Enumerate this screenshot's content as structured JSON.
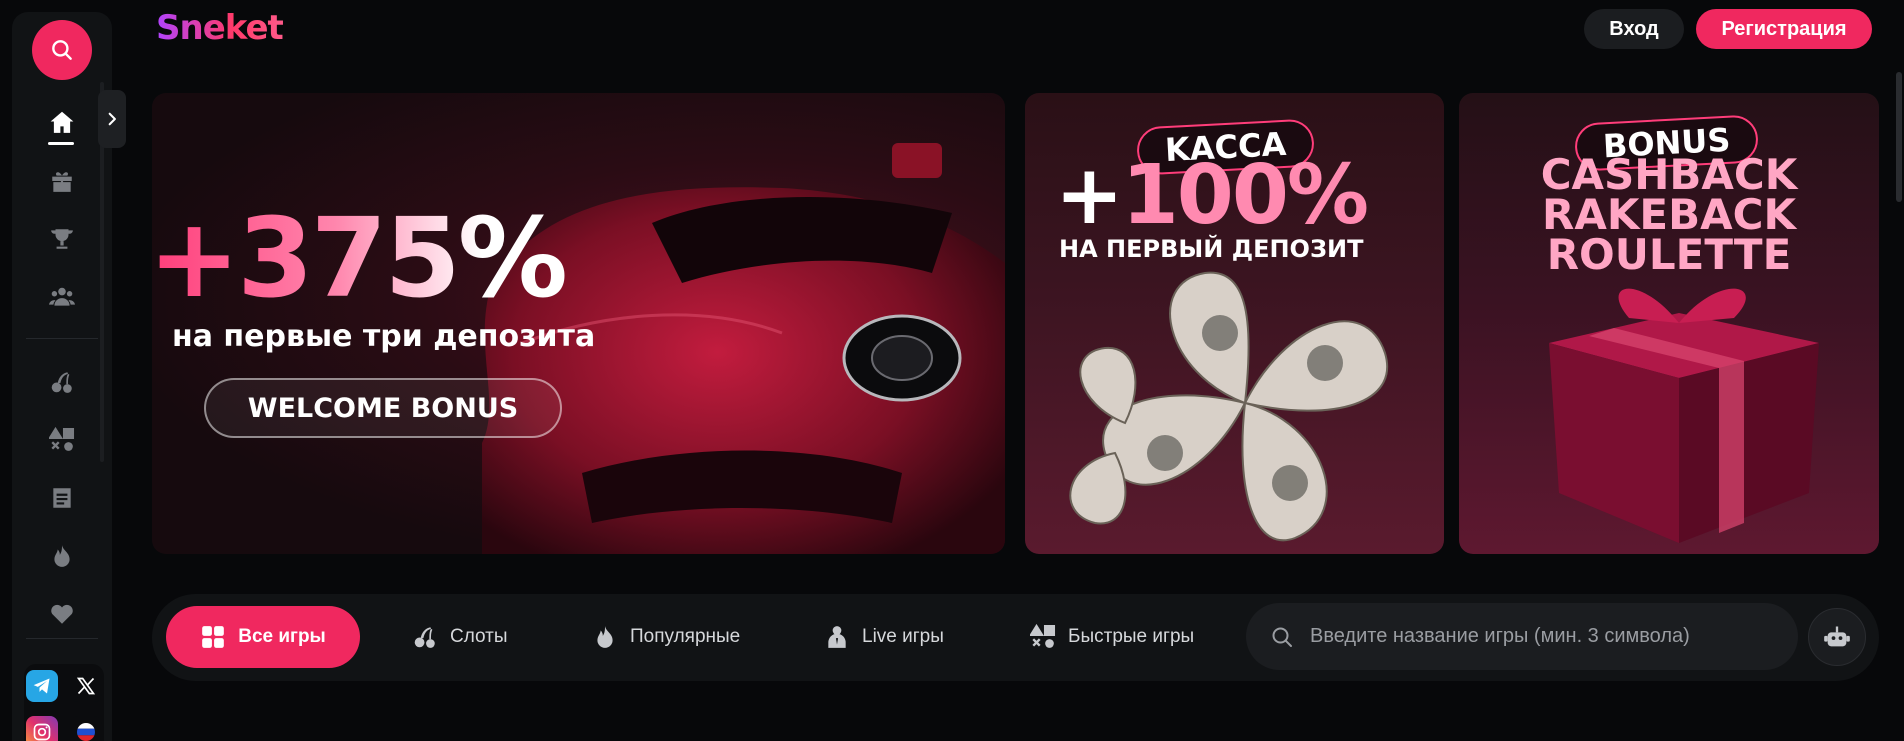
{
  "header": {
    "logo": "Sneket",
    "login_label": "Вход",
    "register_label": "Регистрация"
  },
  "sidebar": {
    "search_icon": "search-icon",
    "expand_icon": "chevron-right-icon",
    "items": [
      {
        "icon": "home-icon",
        "active": true
      },
      {
        "icon": "gift-icon"
      },
      {
        "icon": "trophy-icon"
      },
      {
        "icon": "users-icon"
      },
      {
        "icon": "cherries-icon"
      },
      {
        "icon": "shapes-icon"
      },
      {
        "icon": "document-icon"
      },
      {
        "icon": "flame-icon"
      },
      {
        "icon": "heart-icon"
      }
    ],
    "socials": [
      "telegram-icon",
      "x-icon",
      "instagram-icon",
      "russia-flag-icon"
    ]
  },
  "banners": [
    {
      "headline": "+375%",
      "subtitle": "на первые три депозита",
      "button_label": "WELCOME BONUS"
    },
    {
      "tag": "KACCA",
      "headline_plus": "+",
      "headline_value": "100%",
      "subtitle": "НА ПЕРВЫЙ ДЕПОЗИТ"
    },
    {
      "tag": "BONUS",
      "line1": "CASHBACK",
      "line2": "RAKEBACK",
      "line3": "ROULETTE"
    }
  ],
  "categories": [
    {
      "label": "Все игры",
      "icon": "grid-icon",
      "active": true
    },
    {
      "label": "Слоты",
      "icon": "cherries-icon"
    },
    {
      "label": "Популярные",
      "icon": "flame-icon"
    },
    {
      "label": "Live игры",
      "icon": "dealer-icon"
    },
    {
      "label": "Быстрые игры",
      "icon": "shapes-icon"
    }
  ],
  "search": {
    "placeholder": "Введите название игры (мин. 3 символа)"
  },
  "colors": {
    "accent": "#f0285f",
    "background": "#07080a",
    "panel": "#111315"
  }
}
